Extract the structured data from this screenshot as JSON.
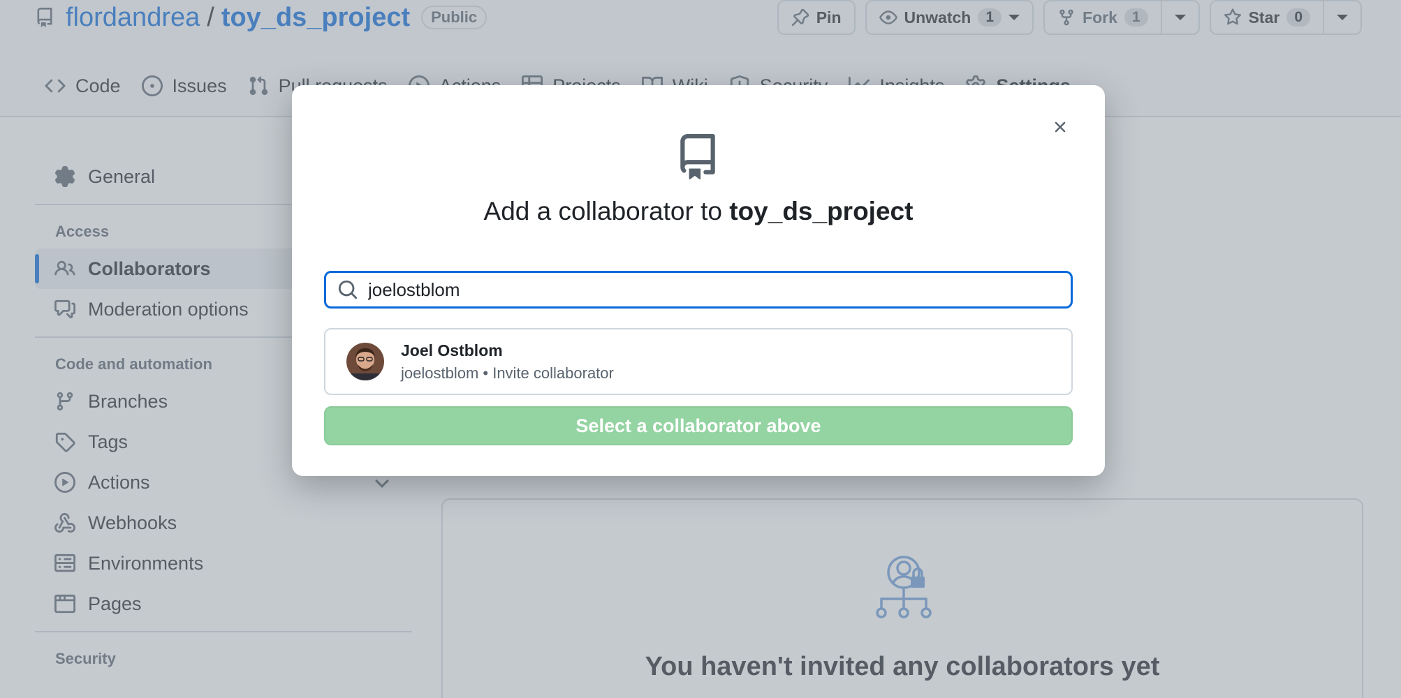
{
  "repo": {
    "owner": "flordandrea",
    "separator": "/",
    "name": "toy_ds_project",
    "visibility": "Public"
  },
  "actions": {
    "pin": "Pin",
    "unwatch": "Unwatch",
    "unwatch_count": "1",
    "fork": "Fork",
    "fork_count": "1",
    "star": "Star",
    "star_count": "0"
  },
  "tabs": [
    {
      "label": "Code",
      "icon": "code-icon"
    },
    {
      "label": "Issues",
      "icon": "issue-icon"
    },
    {
      "label": "Pull requests",
      "icon": "pull-request-icon"
    },
    {
      "label": "Actions",
      "icon": "play-icon"
    },
    {
      "label": "Projects",
      "icon": "table-icon"
    },
    {
      "label": "Wiki",
      "icon": "book-icon"
    },
    {
      "label": "Security",
      "icon": "shield-icon"
    },
    {
      "label": "Insights",
      "icon": "graph-icon"
    },
    {
      "label": "Settings",
      "icon": "gear-icon"
    }
  ],
  "sidebar": {
    "general": "General",
    "access_heading": "Access",
    "collaborators": "Collaborators",
    "moderation": "Moderation options",
    "code_heading": "Code and automation",
    "branches": "Branches",
    "tags": "Tags",
    "actions": "Actions",
    "webhooks": "Webhooks",
    "environments": "Environments",
    "pages": "Pages",
    "security_heading": "Security"
  },
  "main": {
    "empty_title": "You haven't invited any collaborators yet"
  },
  "modal": {
    "title_prefix": "Add a collaborator to ",
    "title_repo": "toy_ds_project",
    "search_value": "joelostblom",
    "result_name": "Joel Ostblom",
    "result_sub": "joelostblom • Invite collaborator",
    "submit_label": "Select a collaborator above"
  },
  "colors": {
    "link": "#0969da",
    "tab_underline": "#fd8c73",
    "submit_disabled": "#94d3a2",
    "focus_border": "#0969da"
  }
}
